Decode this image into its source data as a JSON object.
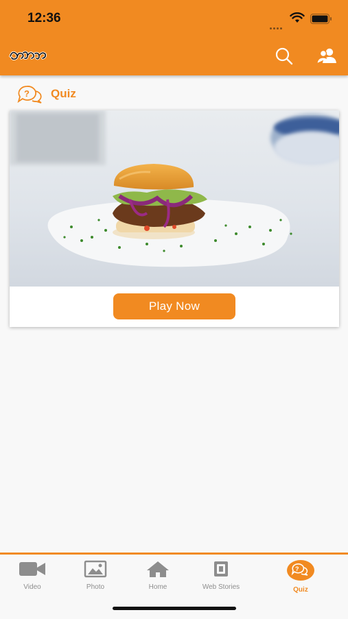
{
  "status_bar": {
    "time": "12:36"
  },
  "header": {
    "logo_text": "ଓଡ଼ିଆ",
    "accent": "#f18a21"
  },
  "section": {
    "title": "Quiz"
  },
  "card": {
    "play_label": "Play Now"
  },
  "tabs": [
    {
      "label": "Video",
      "icon": "video-camera-icon"
    },
    {
      "label": "Photo",
      "icon": "photo-icon"
    },
    {
      "label": "Home",
      "icon": "home-icon"
    },
    {
      "label": "Web Stories",
      "icon": "web-stories-icon"
    },
    {
      "label": "Quiz",
      "icon": "quiz-icon",
      "active": true
    }
  ]
}
